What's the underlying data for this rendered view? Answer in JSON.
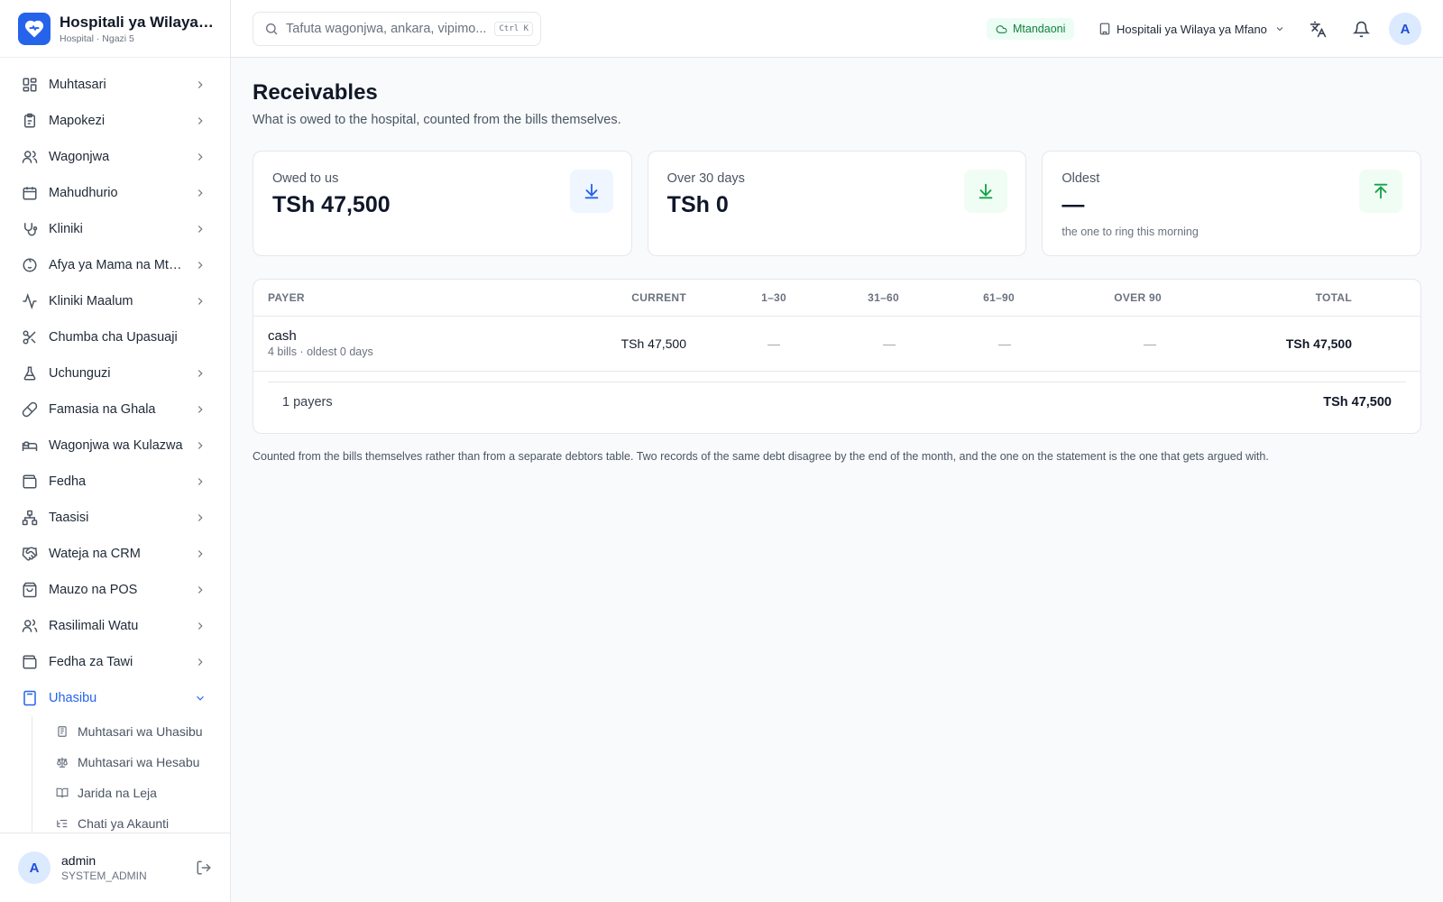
{
  "brand": {
    "title": "Hospitali ya Wilaya ya Mfano",
    "subtitle": "Hospital · Ngazi 5"
  },
  "sidebar": {
    "items": [
      {
        "label": "Muhtasari",
        "icon": "dashboard-icon",
        "chevron": true
      },
      {
        "label": "Mapokezi",
        "icon": "clipboard-icon",
        "chevron": true
      },
      {
        "label": "Wagonjwa",
        "icon": "users-icon",
        "chevron": true
      },
      {
        "label": "Mahudhurio",
        "icon": "calendar-icon",
        "chevron": true
      },
      {
        "label": "Kliniki",
        "icon": "stethoscope-icon",
        "chevron": true
      },
      {
        "label": "Afya ya Mama na Mtoto",
        "icon": "baby-icon",
        "chevron": true
      },
      {
        "label": "Kliniki Maalum",
        "icon": "activity-icon",
        "chevron": true
      },
      {
        "label": "Chumba cha Upasuaji",
        "icon": "scissors-icon",
        "chevron": false
      },
      {
        "label": "Uchunguzi",
        "icon": "flask-icon",
        "chevron": true
      },
      {
        "label": "Famasia na Ghala",
        "icon": "pill-icon",
        "chevron": true
      },
      {
        "label": "Wagonjwa wa Kulazwa",
        "icon": "bed-icon",
        "chevron": true
      },
      {
        "label": "Fedha",
        "icon": "wallet-icon",
        "chevron": true
      },
      {
        "label": "Taasisi",
        "icon": "network-icon",
        "chevron": true
      },
      {
        "label": "Wateja na CRM",
        "icon": "handshake-icon",
        "chevron": true
      },
      {
        "label": "Mauzo na POS",
        "icon": "shopping-bag-icon",
        "chevron": true
      },
      {
        "label": "Rasilimali Watu",
        "icon": "user-group-icon",
        "chevron": true
      },
      {
        "label": "Fedha za Tawi",
        "icon": "wallet-icon",
        "chevron": true
      },
      {
        "label": "Uhasibu",
        "icon": "calculator-icon",
        "chevron": true,
        "expanded": true
      }
    ],
    "subitems": [
      {
        "label": "Muhtasari wa Uhasibu",
        "icon": "receipt-icon"
      },
      {
        "label": "Muhtasari wa Hesabu",
        "icon": "scale-icon"
      },
      {
        "label": "Jarida na Leja",
        "icon": "book-icon"
      },
      {
        "label": "Chati ya Akaunti",
        "icon": "list-tree-icon"
      }
    ]
  },
  "user": {
    "initial": "A",
    "name": "admin",
    "role": "SYSTEM_ADMIN"
  },
  "header": {
    "search_placeholder": "Tafuta wagonjwa, ankara, vipimo...",
    "shortcut": "Ctrl K",
    "status": "Mtandaoni",
    "facility": "Hospitali ya Wilaya ya Mfano",
    "avatar_initial": "A"
  },
  "page": {
    "title": "Receivables",
    "subtitle": "What is owed to the hospital, counted from the bills themselves."
  },
  "cards": [
    {
      "label": "Owed to us",
      "value": "TSh 47,500",
      "note": "",
      "icon": "download-icon",
      "icon_color": "#2563eb",
      "icon_bg": "#eff6ff"
    },
    {
      "label": "Over 30 days",
      "value": "TSh 0",
      "note": "",
      "icon": "download-icon",
      "icon_color": "#16a34a",
      "icon_bg": "#f0fdf4"
    },
    {
      "label": "Oldest",
      "value": "—",
      "note": "the one to ring this morning",
      "icon": "upload-icon",
      "icon_color": "#16a34a",
      "icon_bg": "#f0fdf4"
    }
  ],
  "table": {
    "headers": {
      "payer": "PAYER",
      "current": "CURRENT",
      "d1_30": "1–30",
      "d31_60": "31–60",
      "d61_90": "61–90",
      "over90": "OVER 90",
      "total": "TOTAL"
    },
    "rows": [
      {
        "payer": "cash",
        "meta": "4 bills · oldest 0 days",
        "current": "TSh 47,500",
        "d1_30": "—",
        "d31_60": "—",
        "d61_90": "—",
        "over90": "—",
        "total": "TSh 47,500"
      }
    ],
    "footer": {
      "count": "1 payers",
      "total": "TSh 47,500"
    }
  },
  "footnote": "Counted from the bills themselves rather than from a separate debtors table. Two records of the same debt disagree by the end of the month, and the one on the statement is the one that gets argued with."
}
